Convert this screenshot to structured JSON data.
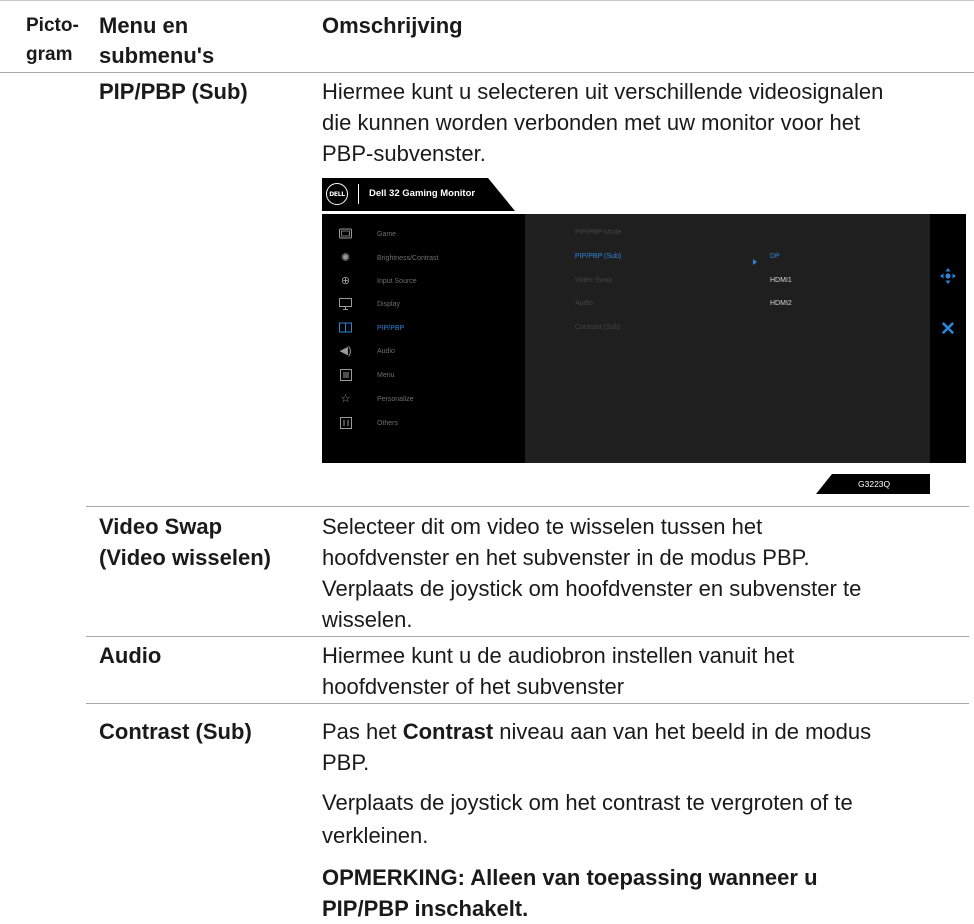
{
  "header": {
    "col1": [
      "Picto-",
      "gram"
    ],
    "col2": [
      "Menu en",
      "submenu's"
    ],
    "col3": "Omschrijving"
  },
  "rows": {
    "pip_sub": {
      "label": "PIP/PBP (Sub)",
      "lines": [
        "Hiermee kunt u selecteren uit verschillende videosignalen",
        "die kunnen worden verbonden met uw monitor voor het",
        "PBP-subvenster."
      ]
    },
    "video_swap": {
      "label": [
        "Video Swap",
        "(Video wisselen)"
      ],
      "lines": [
        "Selecteer dit om video te wisselen tussen het",
        "hoofdvenster en het subvenster in de modus PBP.",
        "Verplaats de joystick om hoofdvenster en subvenster te",
        "wisselen."
      ]
    },
    "audio": {
      "label": "Audio",
      "lines": [
        "Hiermee kunt u de audiobron instellen vanuit het",
        "hoofdvenster of het subvenster"
      ]
    },
    "contrast_sub": {
      "label": "Contrast (Sub)",
      "line1_prefix": "Pas het ",
      "line1_bold": "Contrast",
      "line1_suffix": " niveau aan van het beeld in de modus",
      "line2": "PBP.",
      "para2": [
        "Verplaats de joystick om het contrast te vergroten of te",
        "verkleinen."
      ],
      "note": [
        "OPMERKING: Alleen van toepassing wanneer u",
        "PIP/PBP inschakelt."
      ]
    }
  },
  "osd": {
    "logo": "DELL",
    "title": "Dell 32 Gaming Monitor",
    "menu": [
      {
        "label": "Game",
        "icon": "game-icon"
      },
      {
        "label": "Brightness/Contrast",
        "icon": "brightness-icon"
      },
      {
        "label": "Input Source",
        "icon": "input-source-icon"
      },
      {
        "label": "Display",
        "icon": "display-icon"
      },
      {
        "label": "PIP/PBP",
        "icon": "pip-pbp-icon",
        "active": true
      },
      {
        "label": "Audio",
        "icon": "speaker-icon"
      },
      {
        "label": "Menu",
        "icon": "menu-icon"
      },
      {
        "label": "Personalize",
        "icon": "star-icon"
      },
      {
        "label": "Others",
        "icon": "others-icon"
      }
    ],
    "submenu": [
      "PIP/PBP Mode",
      "PIP/PBP (Sub)",
      "Video Swap",
      "Audio",
      "Contrast (Sub)"
    ],
    "options": [
      "DP",
      "HDMI1",
      "HDMI2"
    ],
    "model": "G3223Q",
    "accent_color": "#2b86d8"
  }
}
